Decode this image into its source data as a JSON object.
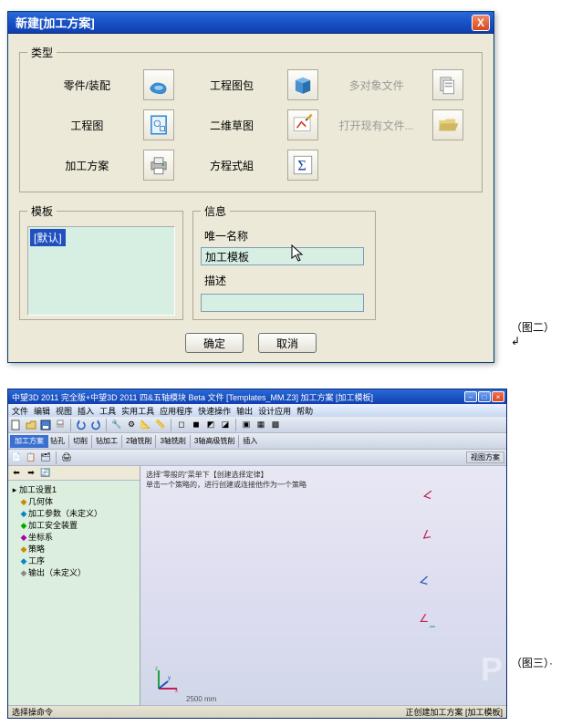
{
  "dialog": {
    "title": "新建[加工方案]",
    "close_x": "X",
    "type_group": "类型",
    "types": {
      "part": "零件/装配",
      "drawing_pkg": "工程图包",
      "multi_file": "多对象文件",
      "drawing": "工程图",
      "sketch2d": "二维草图",
      "open_existing": "打开现有文件...",
      "machining": "加工方案",
      "equation": "方程式組"
    },
    "template_group": "模板",
    "template_items": [
      "[默认]"
    ],
    "info_group": "信息",
    "unique_name_label": "唯一名称",
    "unique_name_value": "加工模板",
    "desc_label": "描述",
    "desc_value": "",
    "ok": "确定",
    "cancel": "取消"
  },
  "captions": {
    "fig2": "（图二）↲",
    "fig3": "（图三）·"
  },
  "app": {
    "title": "中望3D 2011 完全版+中望3D 2011 四&五轴模块 Beta    文件 [Templates_MM.Z3]   加工方案 [加工模板]",
    "menu": [
      "文件",
      "编辑",
      "视图",
      "插入",
      "工具",
      "实用工具",
      "应用程序",
      "快速操作",
      "输出",
      "设计应用",
      "帮助"
    ],
    "tabs": [
      "加工方案",
      "钻孔",
      "切削",
      "钻加工",
      "2轴铣削",
      "3轴铣削",
      "3轴高级铣削",
      "插入"
    ],
    "tree": {
      "root": "加工设置1",
      "items": [
        {
          "label": "几何体",
          "lv": 1
        },
        {
          "label": "加工参数（未定义）",
          "lv": 1
        },
        {
          "label": "加工安全装置",
          "lv": 1
        },
        {
          "label": "坐标系",
          "lv": 1
        },
        {
          "label": "策略",
          "lv": 1
        },
        {
          "label": "工序",
          "lv": 1
        },
        {
          "label": "输出（未定义）",
          "lv": 1
        }
      ]
    },
    "viewport_hint": "选择\"零般的\"菜单下【创建选择定律】\n单击一个策略的，进行创建或连接他作为一个策略",
    "ruler": "2500 mm",
    "status_left": "选择操命令",
    "status_right": "正创建加工方案 [加工模板]"
  },
  "icons": {
    "part": "part-icon",
    "drawing_pkg": "package-icon",
    "multi_file": "files-icon",
    "drawing": "sheet-icon",
    "sketch2d": "sketch-icon",
    "open_existing": "folder-open-icon",
    "machining": "printer-icon",
    "equation": "sigma-icon"
  }
}
